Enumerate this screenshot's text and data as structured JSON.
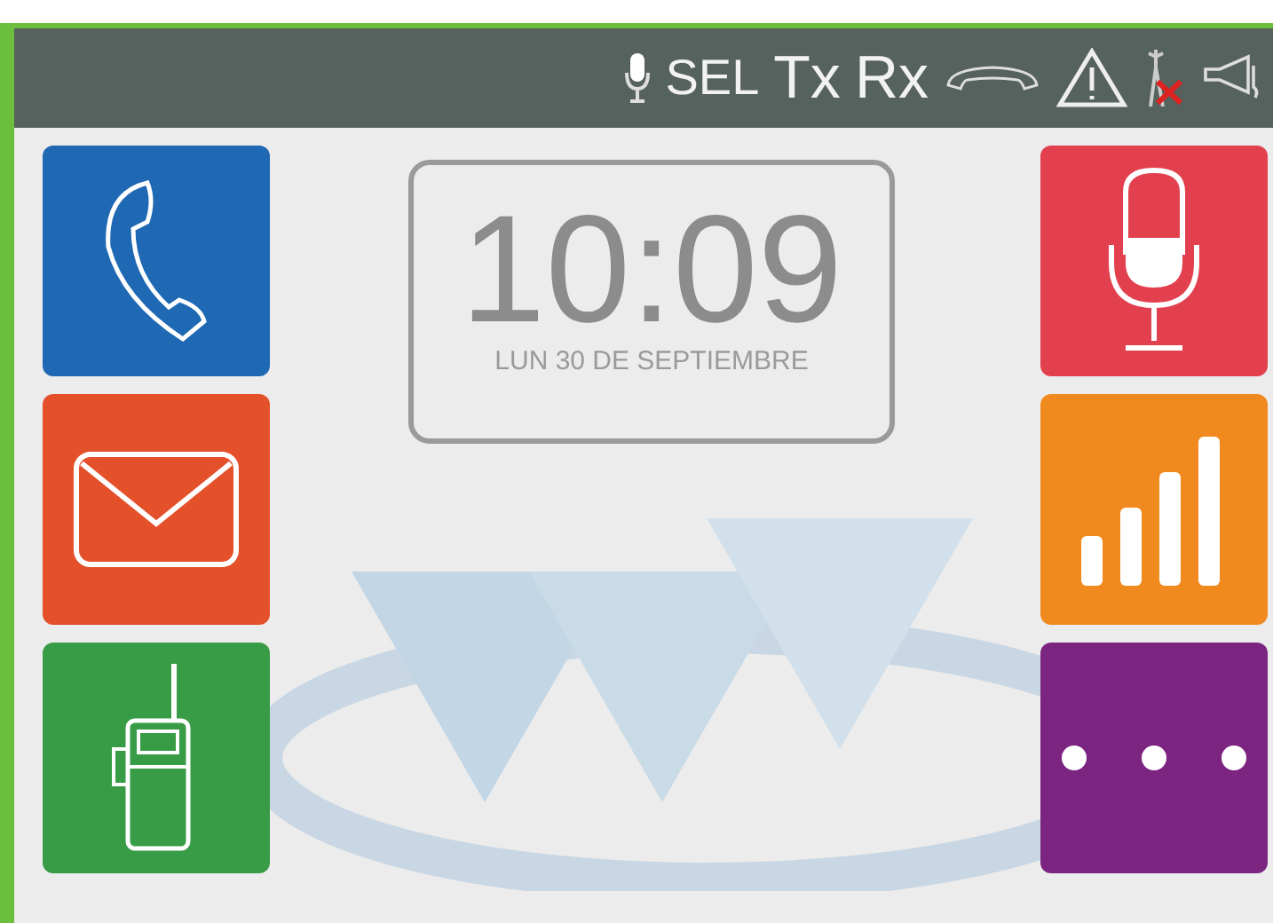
{
  "status_bar": [
    {
      "kind": "mic"
    },
    {
      "kind": "text",
      "label": "SEL",
      "large": false
    },
    {
      "kind": "text",
      "label": "Tx",
      "large": true
    },
    {
      "kind": "text",
      "label": "Rx",
      "large": true
    },
    {
      "kind": "handset"
    },
    {
      "kind": "warning"
    },
    {
      "kind": "antenna-off"
    },
    {
      "kind": "horn"
    }
  ],
  "clock": {
    "time": "10:09",
    "date": "LUN 30 DE SEPTIEMBRE"
  },
  "left_tiles": [
    {
      "kind": "phone",
      "color": "#1f68b3"
    },
    {
      "kind": "mail",
      "color": "#e4502a"
    },
    {
      "kind": "radio",
      "color": "#389c46"
    }
  ],
  "right_tiles": [
    {
      "kind": "mic",
      "color": "#e2404e"
    },
    {
      "kind": "signal",
      "color": "#f08a1f"
    },
    {
      "kind": "more",
      "color": "#7b2581"
    }
  ]
}
